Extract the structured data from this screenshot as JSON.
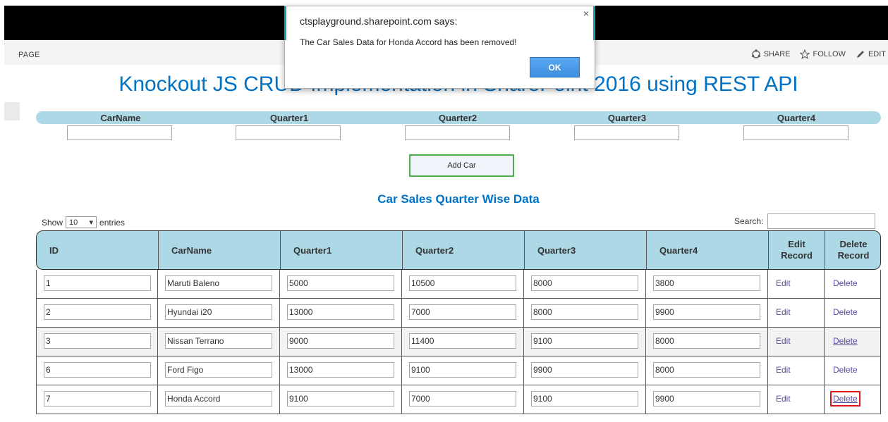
{
  "ribbon": {
    "page_tab": "PAGE",
    "share": "SHARE",
    "follow": "FOLLOW",
    "edit": "EDIT"
  },
  "page_title": "Knockout JS CRUD Implementation in SharePoint 2016 using REST API",
  "form": {
    "headers": [
      "CarName",
      "Quarter1",
      "Quarter2",
      "Quarter3",
      "Quarter4"
    ],
    "add_button": "Add Car"
  },
  "section_title": "Car Sales Quarter Wise Data",
  "table_controls": {
    "show": "Show",
    "entries_value": "10",
    "entries": "entries",
    "search": "Search:"
  },
  "table": {
    "columns": [
      "ID",
      "CarName",
      "Quarter1",
      "Quarter2",
      "Quarter3",
      "Quarter4",
      "Edit Record",
      "Delete Record"
    ],
    "rows": [
      {
        "id": "1",
        "car": "Maruti Baleno",
        "q1": "5000",
        "q2": "10500",
        "q3": "8000",
        "q4": "3800",
        "edit": "Edit",
        "delete": "Delete"
      },
      {
        "id": "2",
        "car": "Hyundai i20",
        "q1": "13000",
        "q2": "7000",
        "q3": "8000",
        "q4": "9900",
        "edit": "Edit",
        "delete": "Delete"
      },
      {
        "id": "3",
        "car": "Nissan Terrano",
        "q1": "9000",
        "q2": "11400",
        "q3": "9100",
        "q4": "8000",
        "edit": "Edit",
        "delete": "Delete"
      },
      {
        "id": "6",
        "car": "Ford Figo",
        "q1": "13000",
        "q2": "9100",
        "q3": "9900",
        "q4": "8000",
        "edit": "Edit",
        "delete": "Delete"
      },
      {
        "id": "7",
        "car": "Honda Accord",
        "q1": "9100",
        "q2": "7000",
        "q3": "9100",
        "q4": "9900",
        "edit": "Edit",
        "delete": "Delete"
      }
    ]
  },
  "dialog": {
    "title": "ctsplayground.sharepoint.com says:",
    "message": "The Car Sales Data for Honda Accord has been removed!",
    "ok": "OK",
    "close": "×"
  },
  "colors": {
    "accent": "#0072c6",
    "header_bg": "#add8e6",
    "highlight": "#e0141c"
  }
}
